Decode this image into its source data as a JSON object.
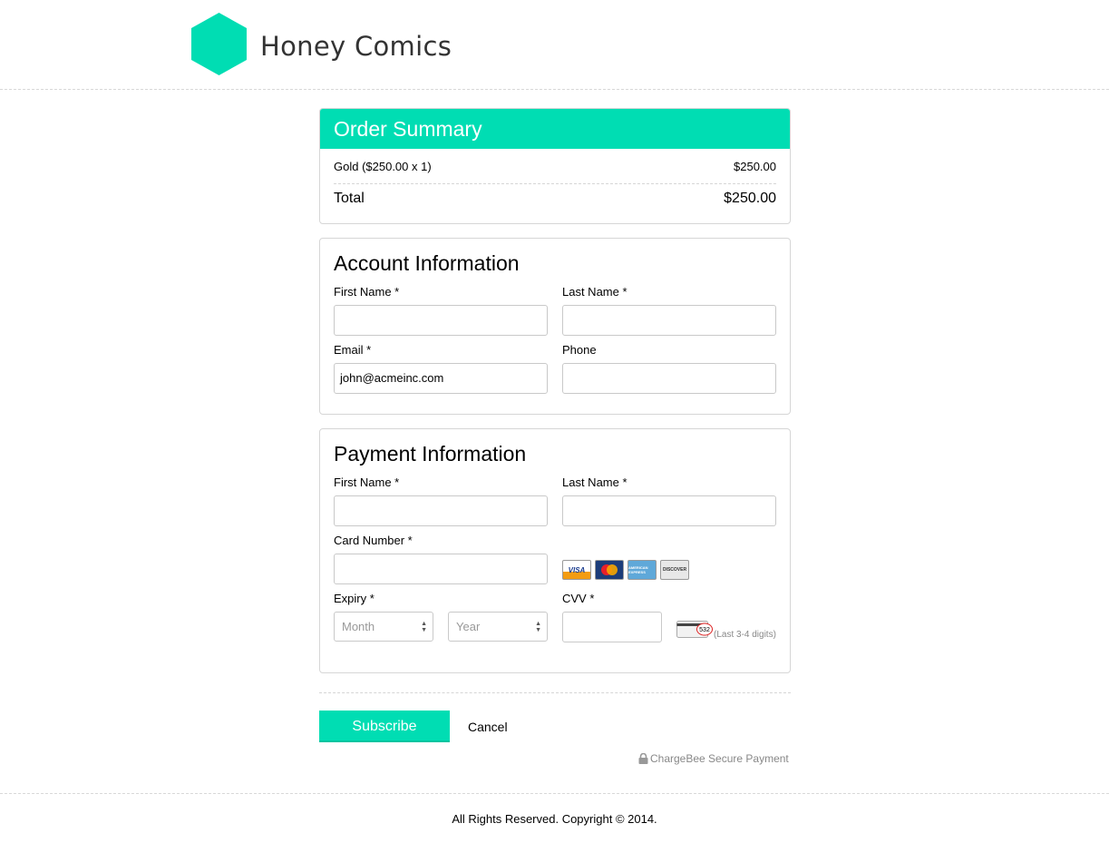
{
  "brand": {
    "name": "Honey Comics",
    "color": "#00ddb3"
  },
  "order_summary": {
    "title": "Order Summary",
    "item_label": "Gold ($250.00 x 1)",
    "item_amount": "$250.00",
    "total_label": "Total",
    "total_amount": "$250.00"
  },
  "account": {
    "title": "Account Information",
    "first_name_label": "First Name *",
    "first_name_value": "",
    "last_name_label": "Last Name *",
    "last_name_value": "",
    "email_label": "Email *",
    "email_value": "john@acmeinc.com",
    "phone_label": "Phone",
    "phone_value": ""
  },
  "payment": {
    "title": "Payment Information",
    "first_name_label": "First Name *",
    "last_name_label": "Last Name *",
    "card_number_label": "Card Number *",
    "card_icons": [
      "VISA",
      "MasterCard",
      "AMERICAN EXPRESS",
      "DISCOVER"
    ],
    "expiry_label": "Expiry *",
    "month_placeholder": "Month",
    "year_placeholder": "Year",
    "cvv_label": "CVV *",
    "cvv_example": "532",
    "cvv_hint": "(Last 3-4 digits)"
  },
  "actions": {
    "subscribe_label": "Subscribe",
    "cancel_label": "Cancel"
  },
  "secure_text": "ChargeBee Secure Payment",
  "footer": {
    "copyright": "All Rights Reserved. Copyright © 2014."
  }
}
